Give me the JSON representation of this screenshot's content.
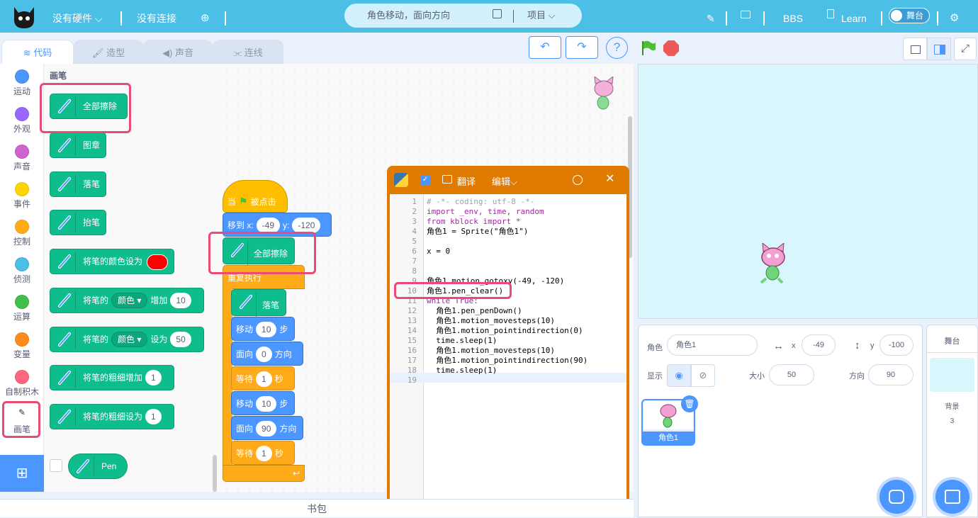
{
  "topbar": {
    "hardware": "没有硬件",
    "connection": "没有连接",
    "project_title": "角色移动，面向方向",
    "project_menu": "项目",
    "bbs": "BBS",
    "learn": "Learn",
    "stage_toggle": "舞台"
  },
  "tabs": [
    "代码",
    "造型",
    "声音",
    "连线"
  ],
  "categories": [
    {
      "label": "运动",
      "color": "#4c97ff"
    },
    {
      "label": "外观",
      "color": "#9966ff"
    },
    {
      "label": "声音",
      "color": "#cf63cf"
    },
    {
      "label": "事件",
      "color": "#ffd500"
    },
    {
      "label": "控制",
      "color": "#ffab19"
    },
    {
      "label": "侦测",
      "color": "#4cbfe6"
    },
    {
      "label": "运算",
      "color": "#40bf4a"
    },
    {
      "label": "变量",
      "color": "#ff8c1a"
    },
    {
      "label": "自制积木",
      "color": "#ff6680"
    },
    {
      "label": "画笔",
      "color": "#0fbd8c"
    }
  ],
  "palette": {
    "heading": "画笔",
    "clear": "全部擦除",
    "stamp": "图章",
    "pendown": "落笔",
    "penup": "抬笔",
    "set_color": "将笔的颜色设为",
    "change_param_a": "将笔的",
    "change_param_dd": "颜色",
    "change_param_b": "增加",
    "change_param_val": "10",
    "set_param_a": "将笔的",
    "set_param_dd": "颜色",
    "set_param_b": "设为",
    "set_param_val": "50",
    "change_size": "将笔的粗细增加",
    "change_size_val": "1",
    "set_size": "将笔的粗细设为",
    "set_size_val": "1",
    "reporter": "Pen",
    "pen_color_value": "#ff0000"
  },
  "script": {
    "hat_a": "当",
    "hat_b": "被点击",
    "goto_a": "移到 x:",
    "goto_x": "-49",
    "goto_b": "y:",
    "goto_y": "-120",
    "clear": "全部擦除",
    "forever": "重复执行",
    "pendown": "落笔",
    "move1_a": "移动",
    "move1_v": "10",
    "move1_b": "步",
    "point1_a": "面向",
    "point1_v": "0",
    "point1_b": "方向",
    "wait1_a": "等待",
    "wait1_v": "1",
    "wait1_b": "秒",
    "move2_a": "移动",
    "move2_v": "10",
    "move2_b": "步",
    "point2_a": "面向",
    "point2_v": "90",
    "point2_b": "方向",
    "wait2_a": "等待",
    "wait2_v": "1",
    "wait2_b": "秒"
  },
  "codewin": {
    "translate": "翻译",
    "edit": "编辑",
    "lines": [
      "# -*- coding: utf-8 -*-",
      "import _env, time, random",
      "from kblock import *",
      "角色1 = Sprite(\"角色1\")",
      "",
      "x = 0",
      "",
      "",
      "角色1.motion_gotoxy(-49, -120)",
      "角色1.pen_clear()",
      "while True:",
      "  角色1.pen_penDown()",
      "  角色1.motion_movesteps(10)",
      "  角色1.motion_pointindirection(0)",
      "  time.sleep(1)",
      "  角色1.motion_movesteps(10)",
      "  角色1.motion_pointindirection(90)",
      "  time.sleep(1)",
      ""
    ]
  },
  "sprite": {
    "label_sprite": "角色",
    "name": "角色1",
    "label_x": "x",
    "x": "-49",
    "label_y": "y",
    "y": "-100",
    "label_show": "显示",
    "label_size": "大小",
    "size": "50",
    "label_dir": "方向",
    "dir": "90",
    "thumb_name": "角色1"
  },
  "stagepanel": {
    "title": "舞台",
    "backdrops_label": "背景",
    "backdrops": "3"
  },
  "backpack": "书包"
}
